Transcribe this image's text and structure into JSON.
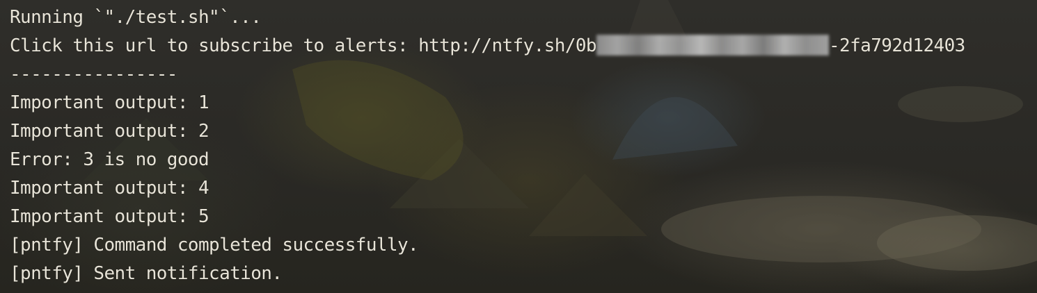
{
  "terminal": {
    "top_partial_text": "                                              ",
    "lines": [
      "Running `\"./test.sh\"`...",
      "Click this url to subscribe to alerts: http://ntfy.sh/0b",
      "----------------",
      "Important output: 1",
      "Important output: 2",
      "Error: 3 is no good",
      "Important output: 4",
      "Important output: 5",
      "[pntfy] Command completed successfully.",
      "[pntfy] Sent notification."
    ],
    "url_suffix": "-2fa792d12403"
  },
  "colors": {
    "background": "#2b2a26",
    "text": "#e8e4d8",
    "accent_green": "#8cc63f"
  }
}
